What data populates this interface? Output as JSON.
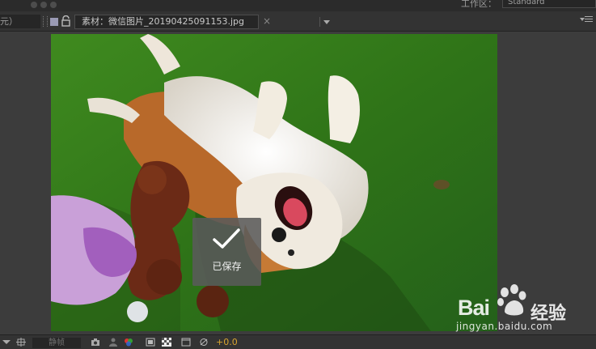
{
  "topbar": {
    "workspace_label": "工作区：",
    "workspace_value": "Standard"
  },
  "left_panel_tab": {
    "label": "元）"
  },
  "footage_tab": {
    "label": "素材：微信图片_20190425091153.jpg",
    "close_glyph": "×"
  },
  "toast": {
    "label": "已保存"
  },
  "watermark": {
    "brand_left": "Bai",
    "brand_right": "经验",
    "url": "jingyan.baidu.com"
  },
  "bottom_toolbar": {
    "snapshot_field": "静帧",
    "exposure": "+0.0"
  },
  "colors": {
    "panel_bg": "#3c3c3c",
    "exposure_color": "#d8a530",
    "toast_bg": "#5a5a5a"
  }
}
